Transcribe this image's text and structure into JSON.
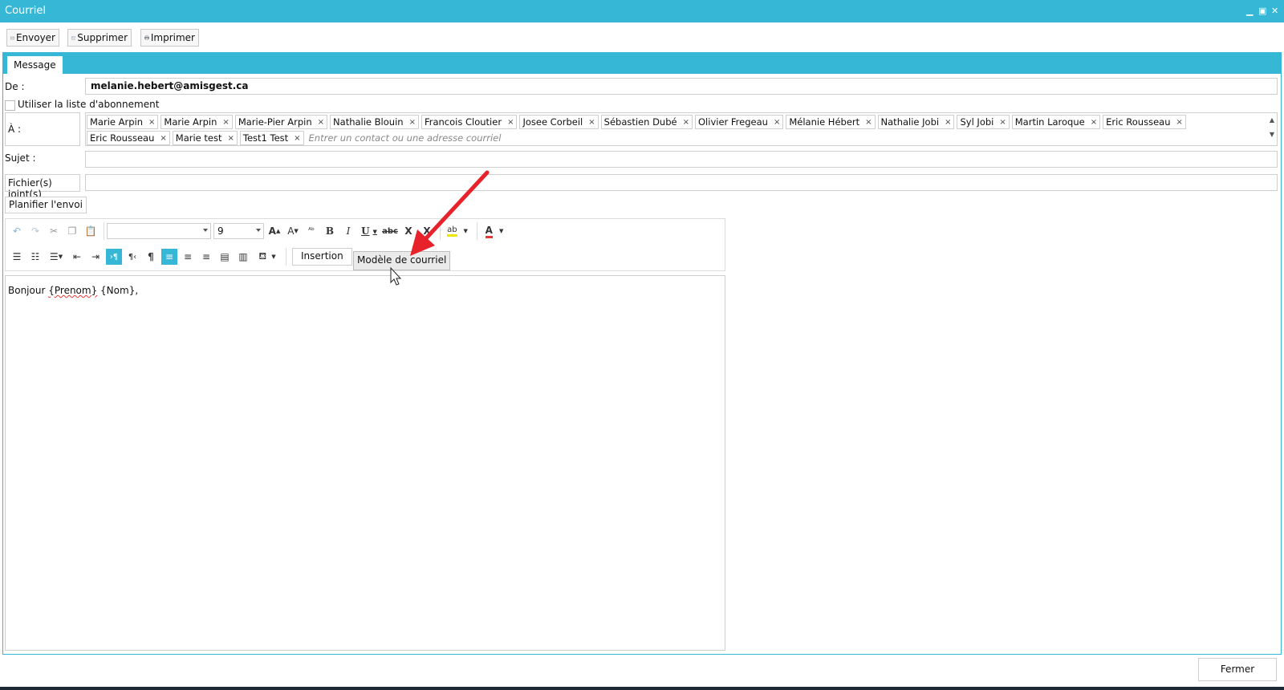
{
  "window": {
    "title": "Courriel",
    "controls": [
      "minimize-icon",
      "maximize-icon",
      "close-icon"
    ],
    "accent": "#36b7d6"
  },
  "toolbar": {
    "send_label": "Envoyer",
    "delete_label": "Supprimer",
    "print_label": "Imprimer"
  },
  "tabs": [
    {
      "label": "Message",
      "selected": true
    }
  ],
  "form": {
    "from_label": "De :",
    "from_value": "melanie.hebert@amisgest.ca",
    "subscription_label": "Utiliser la liste d'abonnement",
    "subscription_checked": false,
    "to_label": "À :",
    "recipients": [
      "Marie Arpin",
      "Marie Arpin",
      "Marie-Pier  Arpin",
      "Nathalie Blouin",
      "Francois Cloutier",
      "Josee Corbeil",
      "Sébastien Dubé",
      "Olivier Fregeau",
      "Mélanie Hébert",
      "Nathalie Jobi",
      "Syl Jobi",
      "Martin Laroque",
      "Eric Rousseau",
      "Eric Rousseau",
      "Marie test",
      "Test1 Test"
    ],
    "recipient_remove_glyph": "×",
    "to_placeholder": "Entrer un contact ou une adresse courriel",
    "subject_label": "Sujet :",
    "subject_value": "",
    "attachments_label": "Fichier(s) joint(s)",
    "attachments_value": "",
    "schedule_label": "Planifier l'envoi"
  },
  "editor_toolbar": {
    "font_name": "",
    "font_size": "9",
    "insertion_label": "Insertion",
    "template_label": "Modèle de courriel",
    "row1_icons": [
      "undo-icon",
      "redo-icon",
      "cut-icon",
      "copy-icon",
      "paste-icon",
      "grow-font-icon",
      "shrink-font-icon",
      "change-case-icon",
      "bold-icon",
      "italic-icon",
      "underline-icon",
      "strikethrough-icon",
      "clear-format-icon",
      "highlight-icon",
      "font-color-icon"
    ],
    "row2_icons": [
      "bullets-icon",
      "numbering-icon",
      "multilevel-list-icon",
      "decrease-indent-icon",
      "increase-indent-icon",
      "ltr-icon",
      "rtl-icon",
      "show-marks-icon",
      "align-left-icon",
      "align-center-icon",
      "align-right-icon",
      "justify-icon",
      "line-spacing-icon",
      "shading-icon"
    ]
  },
  "editor": {
    "greeting": "Bonjour",
    "field_prenom": "{Prenom}",
    "field_nom": "{Nom},"
  },
  "footer": {
    "close_label": "Fermer"
  },
  "annotation": {
    "arrow_color": "#e8222a"
  }
}
